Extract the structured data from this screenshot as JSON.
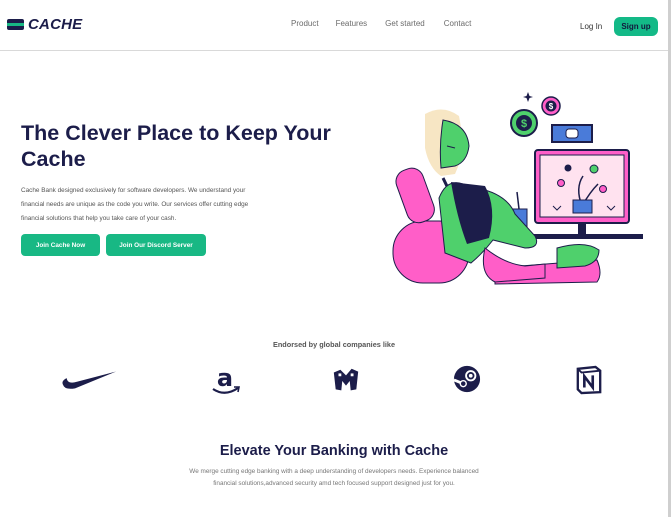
{
  "header": {
    "logo_text": "CACHE",
    "nav": [
      "Product",
      "Features",
      "Get started",
      "Contact"
    ],
    "login_label": "Log In",
    "signup_label": "Sign up"
  },
  "hero": {
    "title": "The Clever Place to Keep Your Cache",
    "description": "Cache Bank designed exclusively for software developers. We understand your financial needs are unique as the code you write. Our services offer cutting edge financial solutions that help you take care of your cash.",
    "primary_button": "Join Cache Now",
    "secondary_button": "Join Our Discord Server"
  },
  "endorsements": {
    "heading": "Endorsed by global companies like",
    "brands": [
      "nike-logo",
      "amazon-logo",
      "company-m-logo",
      "steam-logo",
      "notion-logo"
    ]
  },
  "section": {
    "title": "Elevate Your Banking with Cache",
    "description": "We merge cutting edge banking with a deep understanding of developers needs. Experience balanced financial solutions,advanced security amd tech focused support designed just for you."
  },
  "colors": {
    "navy": "#1c1d4a",
    "accent_green": "#18b884",
    "pink": "#ff5ec8",
    "illustration_green": "#4fd06c"
  }
}
